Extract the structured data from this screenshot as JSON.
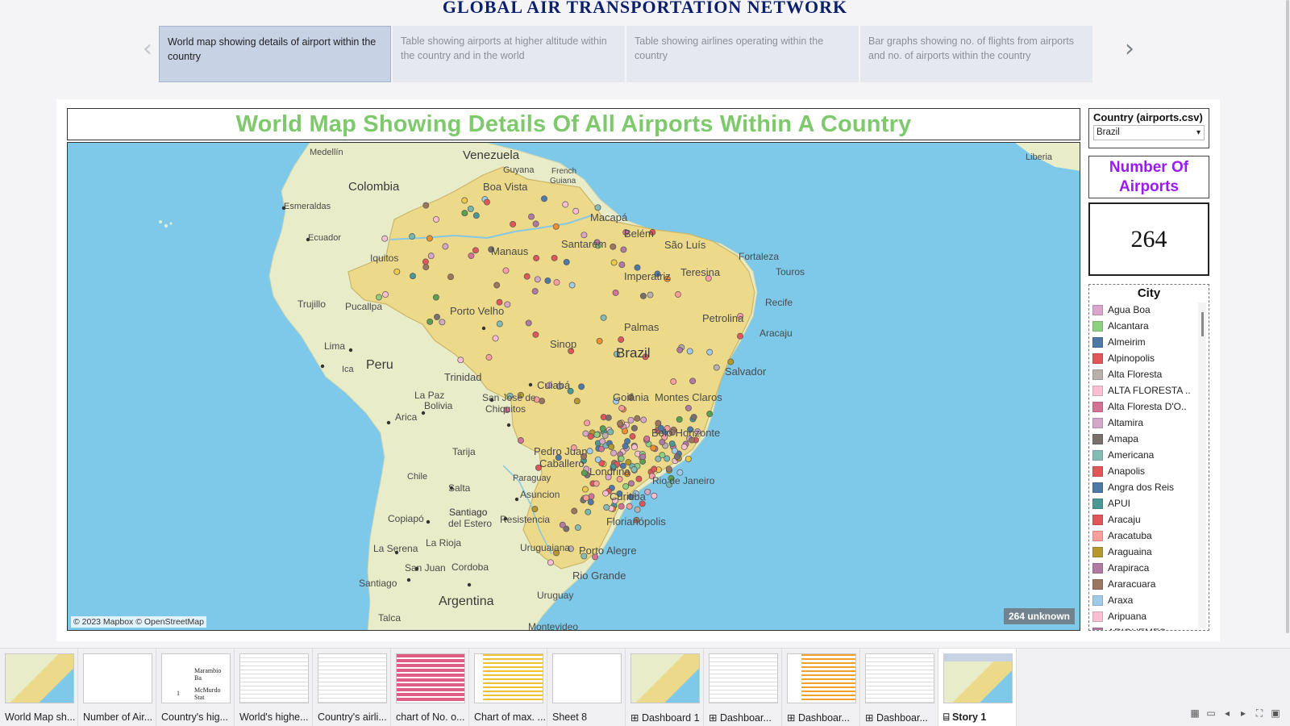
{
  "story": {
    "title": "GLOBAL AIR TRANSPORTATION NETWORK",
    "points": [
      {
        "text": "World map showing details of airport within the country",
        "active": true
      },
      {
        "text": "Table showing airports at higher altitude within the country and in the world",
        "active": false
      },
      {
        "text": "Table showing airlines operating within the country",
        "active": false
      },
      {
        "text": "Bar graphs showing no. of flights from airports and no. of airports within the country",
        "active": false
      }
    ],
    "prev_icon": "‹",
    "next_icon": "›"
  },
  "map": {
    "title": "World Map Showing Details Of All Airports Within A Country",
    "attribution": "© 2023 Mapbox © OpenStreetMap",
    "unknown_badge": "264 unknown",
    "place_labels": [
      {
        "name": "Venezuela"
      },
      {
        "name": "Medellín"
      },
      {
        "name": "Guyana"
      },
      {
        "name": "French Guiana"
      },
      {
        "name": "Boa Vista"
      },
      {
        "name": "Colombia"
      },
      {
        "name": "Esmeraldas"
      },
      {
        "name": "Ecuador"
      },
      {
        "name": "Macapá"
      },
      {
        "name": "Belém"
      },
      {
        "name": "Manaus"
      },
      {
        "name": "Santarém"
      },
      {
        "name": "São Luís"
      },
      {
        "name": "Fortaleza"
      },
      {
        "name": "Iquitos"
      },
      {
        "name": "Imperatriz"
      },
      {
        "name": "Teresina"
      },
      {
        "name": "Touros"
      },
      {
        "name": "Trujillo"
      },
      {
        "name": "Pucallpa"
      },
      {
        "name": "Porto Velho"
      },
      {
        "name": "Petrolina"
      },
      {
        "name": "Recife"
      },
      {
        "name": "Palmas"
      },
      {
        "name": "Lima"
      },
      {
        "name": "Sinop"
      },
      {
        "name": "Brazil"
      },
      {
        "name": "Aracaju"
      },
      {
        "name": "Peru"
      },
      {
        "name": "Ica"
      },
      {
        "name": "Trinidad"
      },
      {
        "name": "Salvador"
      },
      {
        "name": "La Paz"
      },
      {
        "name": "Cuiabá"
      },
      {
        "name": "Goiânia"
      },
      {
        "name": "Montes Claros"
      },
      {
        "name": "Bolivia"
      },
      {
        "name": "San José de Chiquitos"
      },
      {
        "name": "Arica"
      },
      {
        "name": "Belo Horizonte"
      },
      {
        "name": "Tarija"
      },
      {
        "name": "Pedro Juan Caballero"
      },
      {
        "name": "Chile"
      },
      {
        "name": "Paraguay"
      },
      {
        "name": "Londrina"
      },
      {
        "name": "Rio de Janeiro"
      },
      {
        "name": "Salta"
      },
      {
        "name": "Asuncion"
      },
      {
        "name": "Curitiba"
      },
      {
        "name": "Copiapó"
      },
      {
        "name": "Santiago del Estero"
      },
      {
        "name": "Resistencia"
      },
      {
        "name": "Florianópolis"
      },
      {
        "name": "Uruguaiana"
      },
      {
        "name": "La Serena"
      },
      {
        "name": "La Rioja"
      },
      {
        "name": "Porto Alegre"
      },
      {
        "name": "San Juan"
      },
      {
        "name": "Cordoba"
      },
      {
        "name": "Rio Grande"
      },
      {
        "name": "Santiago"
      },
      {
        "name": "Argentina"
      },
      {
        "name": "Uruguay"
      },
      {
        "name": "Talca"
      },
      {
        "name": "Montevideo"
      },
      {
        "name": "Liberia"
      }
    ]
  },
  "filter": {
    "title": "Country (airports.csv)",
    "selected": "Brazil",
    "caret_icon": "▾"
  },
  "kpi": {
    "title": "Number Of Airports",
    "value": "264"
  },
  "legend": {
    "title": "City",
    "items": [
      {
        "label": "Agua Boa",
        "color": "#d9a6c9"
      },
      {
        "label": "Alcantara",
        "color": "#8cd17d"
      },
      {
        "label": "Almeirim",
        "color": "#4e79a7"
      },
      {
        "label": "Alpinopolis",
        "color": "#e15759"
      },
      {
        "label": "Alta Floresta",
        "color": "#bab0ac"
      },
      {
        "label": "ALTA FLORESTA ..",
        "color": "#fabfd2"
      },
      {
        "label": "Alta Floresta D'O..",
        "color": "#d37295"
      },
      {
        "label": "Altamira",
        "color": "#d4a6c8"
      },
      {
        "label": "Amapa",
        "color": "#79706e"
      },
      {
        "label": "Americana",
        "color": "#86bcb6"
      },
      {
        "label": "Anapolis",
        "color": "#e15759"
      },
      {
        "label": "Angra dos Reis",
        "color": "#4e79a7"
      },
      {
        "label": "APUI",
        "color": "#499894"
      },
      {
        "label": "Aracaju",
        "color": "#e15759"
      },
      {
        "label": "Aracatuba",
        "color": "#ff9d9a"
      },
      {
        "label": "Araguaina",
        "color": "#b6992d"
      },
      {
        "label": "Arapiraca",
        "color": "#b07aa1"
      },
      {
        "label": "Araracuara",
        "color": "#9d7660"
      },
      {
        "label": "Araxa",
        "color": "#a0cbe8"
      },
      {
        "label": "Aripuana",
        "color": "#fabfd2"
      },
      {
        "label": "ARIQUEMES",
        "color": "#b07aa1"
      }
    ]
  },
  "sheets": [
    {
      "label": "World Map sh...",
      "icon": ""
    },
    {
      "label": "Number of Air...",
      "icon": ""
    },
    {
      "label": "Country's hig...",
      "icon": ""
    },
    {
      "label": "World's highe...",
      "icon": ""
    },
    {
      "label": "Country's airli...",
      "icon": ""
    },
    {
      "label": "chart of No. o...",
      "icon": ""
    },
    {
      "label": "Chart of max. ...",
      "icon": ""
    },
    {
      "label": "Sheet 8",
      "icon": ""
    },
    {
      "label": "Dashboard 1",
      "icon": "⊞"
    },
    {
      "label": "Dashboar...",
      "icon": "⊞"
    },
    {
      "label": "Dashboar...",
      "icon": "⊞"
    },
    {
      "label": "Dashboar...",
      "icon": "⊞"
    },
    {
      "label": "Story 1",
      "icon": "⌸"
    }
  ],
  "thumb_texts": {
    "t3a": "Marambio Ba",
    "t3b": "McMurdo Stat",
    "t3c": "1"
  },
  "colors": {
    "ocean": "#7ec8ea",
    "land": "#e8ecc8",
    "brazil": "#ecd989",
    "title_green": "#7dc96c",
    "kpi_purple": "#9b19f5",
    "story_blue": "#0b1f6b"
  }
}
